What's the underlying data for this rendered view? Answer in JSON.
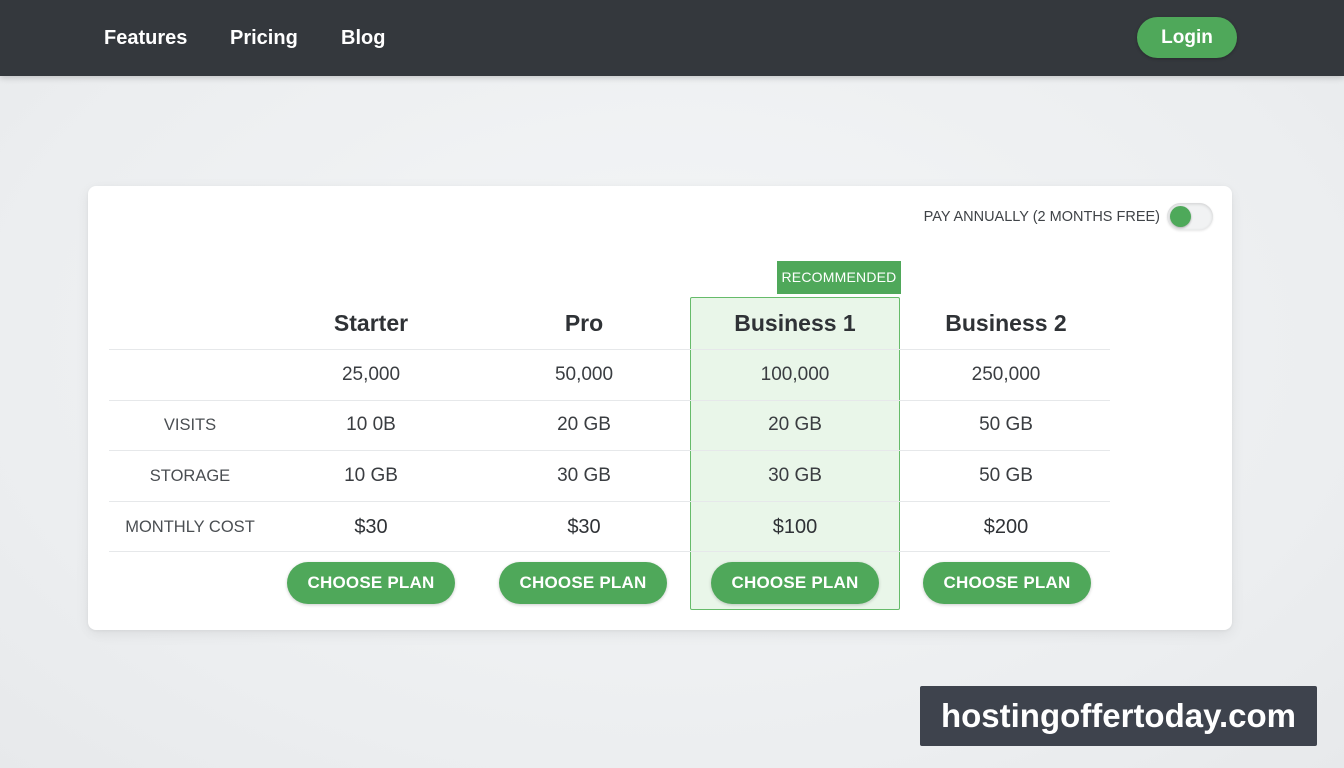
{
  "nav": {
    "links": [
      "Features",
      "Pricing",
      "Blog"
    ],
    "login_label": "Login"
  },
  "billing": {
    "annual_label": "PAY ANNUALLY (2 MONTHS FREE)",
    "annual_enabled": true
  },
  "recommended_badge": "RECOMMENDED",
  "plans": [
    {
      "name": "Starter",
      "row1": "25,000",
      "visits": "10 0B",
      "storage": "10 GB",
      "cost": "$30",
      "cta": "CHOOSE PLAN",
      "recommended": false
    },
    {
      "name": "Pro",
      "row1": "50,000",
      "visits": "20 GB",
      "storage": "30 GB",
      "cost": "$30",
      "cta": "CHOOSE PLAN",
      "recommended": false
    },
    {
      "name": "Business 1",
      "row1": "100,000",
      "visits": "20 GB",
      "storage": "30 GB",
      "cost": "$100",
      "cta": "CHOOSE PLAN",
      "recommended": true
    },
    {
      "name": "Business 2",
      "row1": "250,000",
      "visits": "50 GB",
      "storage": "50 GB",
      "cost": "$200",
      "cta": "CHOOSE PLAN",
      "recommended": false
    }
  ],
  "row_labels": {
    "row1": "",
    "visits": "VISITS",
    "storage": "STORAGE",
    "cost": "MONTHLY COST"
  },
  "colors": {
    "accent": "#4fa85a",
    "nav_bg": "#34383d",
    "highlight_border": "#66bb6a"
  },
  "watermark": "hostingoffertoday.com"
}
